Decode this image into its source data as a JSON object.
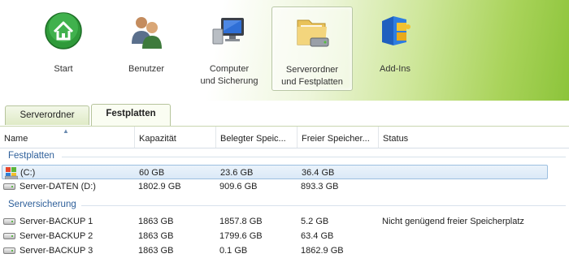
{
  "nav": [
    {
      "label": "Start",
      "icon": "home-icon"
    },
    {
      "label": "Benutzer",
      "icon": "users-icon"
    },
    {
      "label": "Computer\nund Sicherung",
      "icon": "computer-icon"
    },
    {
      "label": "Serverordner\nund Festplatten",
      "icon": "folder-drive-icon",
      "selected": true
    },
    {
      "label": "Add-Ins",
      "icon": "addins-icon"
    }
  ],
  "tabs": [
    {
      "label": "Serverordner"
    },
    {
      "label": "Festplatten",
      "active": true
    }
  ],
  "columns": [
    "Name",
    "Kapazität",
    "Belegter Speic...",
    "Freier Speicher...",
    "Status"
  ],
  "groups": [
    {
      "title": "Festplatten",
      "rows": [
        {
          "name": "(C:)",
          "icon": "windows-drive-icon",
          "capacity": "60 GB",
          "used": "23.6 GB",
          "free": "36.4 GB",
          "status": "",
          "selected": true
        },
        {
          "name": "Server-DATEN (D:)",
          "icon": "hard-drive-icon",
          "capacity": "1802.9 GB",
          "used": "909.6 GB",
          "free": "893.3 GB",
          "status": ""
        }
      ]
    },
    {
      "title": "Serversicherung",
      "rows": [
        {
          "name": "Server-BACKUP 1",
          "icon": "hard-drive-icon",
          "capacity": "1863 GB",
          "used": "1857.8 GB",
          "free": "5.2 GB",
          "status": "Nicht genügend freier Speicherplatz"
        },
        {
          "name": "Server-BACKUP 2",
          "icon": "hard-drive-icon",
          "capacity": "1863 GB",
          "used": "1799.6 GB",
          "free": "63.4 GB",
          "status": ""
        },
        {
          "name": "Server-BACKUP 3",
          "icon": "hard-drive-icon",
          "capacity": "1863 GB",
          "used": "0.1 GB",
          "free": "1862.9 GB",
          "status": ""
        }
      ]
    }
  ]
}
